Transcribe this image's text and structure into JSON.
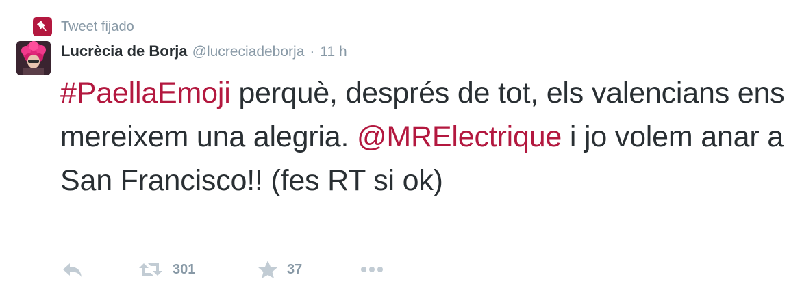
{
  "pinned": {
    "label": "Tweet fijado",
    "icon": "pin-icon",
    "badge_color": "#b3183f"
  },
  "author": {
    "fullname": "Lucrècia de Borja",
    "username": "@lucreciadeborja",
    "separator": "·",
    "timestamp": "11 h",
    "avatar": "avatar-photo"
  },
  "tweet": {
    "segments": [
      {
        "text": "#PaellaEmoji",
        "type": "hashtag"
      },
      {
        "text": " perquè, després de tot, els valencians ens mereixem una alegria. ",
        "type": "text"
      },
      {
        "text": "@MRElectrique",
        "type": "mention"
      },
      {
        "text": " i jo volem anar a San Francisco!! (fes RT si ok)",
        "type": "text"
      }
    ],
    "link_color": "#b3183f",
    "text_color": "#292f33"
  },
  "actions": {
    "reply": {
      "icon": "reply-icon"
    },
    "retweet": {
      "icon": "retweet-icon",
      "count": "301"
    },
    "favorite": {
      "icon": "star-icon",
      "count": "37"
    },
    "more": {
      "icon": "more-icon"
    },
    "icon_color": "#8899a6"
  }
}
